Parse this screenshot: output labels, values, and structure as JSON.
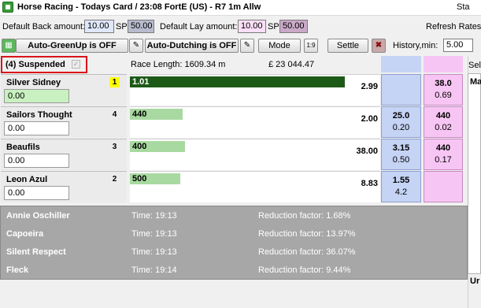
{
  "window": {
    "title": "Horse Racing - Todays Card / 23:08 FortE (US) - R7 1m Allw",
    "right_text": "Sta"
  },
  "toolbar": {
    "default_back_label": "Default Back amount:",
    "default_back_value": "10.00",
    "sp_label": "SP",
    "default_back_sp_value": "50.00",
    "default_lay_label": "Default Lay amount:",
    "default_lay_value": "10.00",
    "default_lay_sp_value": "50.00",
    "refresh_rates_label": "Refresh Rates",
    "auto_greenup_label": "Auto-GreenUp is OFF",
    "auto_dutching_label": "Auto-Dutching is OFF",
    "mode_label": "Mode",
    "ratio_icon_label": "1:9",
    "settle_label": "Settle",
    "history_label": "History,min:",
    "history_value": "5.00"
  },
  "market": {
    "status": "(4) Suspended",
    "race_length": "Race Length: 1609.34 m",
    "matched": "£ 23 044.47",
    "right_header_fragment": "Sele",
    "right_col_fragment": "Ma",
    "right_bottom_fragment": "Ur"
  },
  "runners": [
    {
      "name": "Silver Sidney",
      "cloth": "1",
      "pl": "0.00",
      "bar_label": "1.01",
      "bar_fraction": 0.86,
      "bar_color": "#1e5a17",
      "bar_label_color": "#ffffff",
      "odds": "2.99",
      "back_price": "",
      "back_size": "",
      "lay_price": "38.0",
      "lay_size": "0.69"
    },
    {
      "name": "Sailors Thought",
      "cloth": "4",
      "pl": "0.00",
      "bar_label": "440",
      "bar_fraction": 0.21,
      "bar_color": "#a8d9a0",
      "bar_label_color": "#000000",
      "odds": "2.00",
      "back_price": "25.0",
      "back_size": "0.20",
      "lay_price": "440",
      "lay_size": "0.02"
    },
    {
      "name": "Beaufils",
      "cloth": "3",
      "pl": "0.00",
      "bar_label": "400",
      "bar_fraction": 0.22,
      "bar_color": "#a8d9a0",
      "bar_label_color": "#000000",
      "odds": "38.00",
      "back_price": "3.15",
      "back_size": "0.50",
      "lay_price": "440",
      "lay_size": "0.17"
    },
    {
      "name": "Leon Azul",
      "cloth": "2",
      "pl": "0.00",
      "bar_label": "500",
      "bar_fraction": 0.2,
      "bar_color": "#a8d9a0",
      "bar_label_color": "#000000",
      "odds": "8.83",
      "back_price": "1.55",
      "back_size": "4.2",
      "lay_price": "",
      "lay_size": ""
    }
  ],
  "finished": [
    {
      "name": "Annie Oschiller",
      "time": "Time: 19:13",
      "reduction": "Reduction factor: 1.68%"
    },
    {
      "name": "Capoeira",
      "time": "Time: 19:13",
      "reduction": "Reduction factor: 13.97%"
    },
    {
      "name": "Silent Respect",
      "time": "Time: 19:13",
      "reduction": "Reduction factor: 36.07%"
    },
    {
      "name": "Fleck",
      "time": "Time: 19:14",
      "reduction": "Reduction factor: 9.44%"
    }
  ],
  "colors": {
    "back": "#c5d3f4",
    "lay": "#f7c5f3",
    "suspended_border": "#d9141b",
    "cloth_highlight": "#ffff00"
  }
}
